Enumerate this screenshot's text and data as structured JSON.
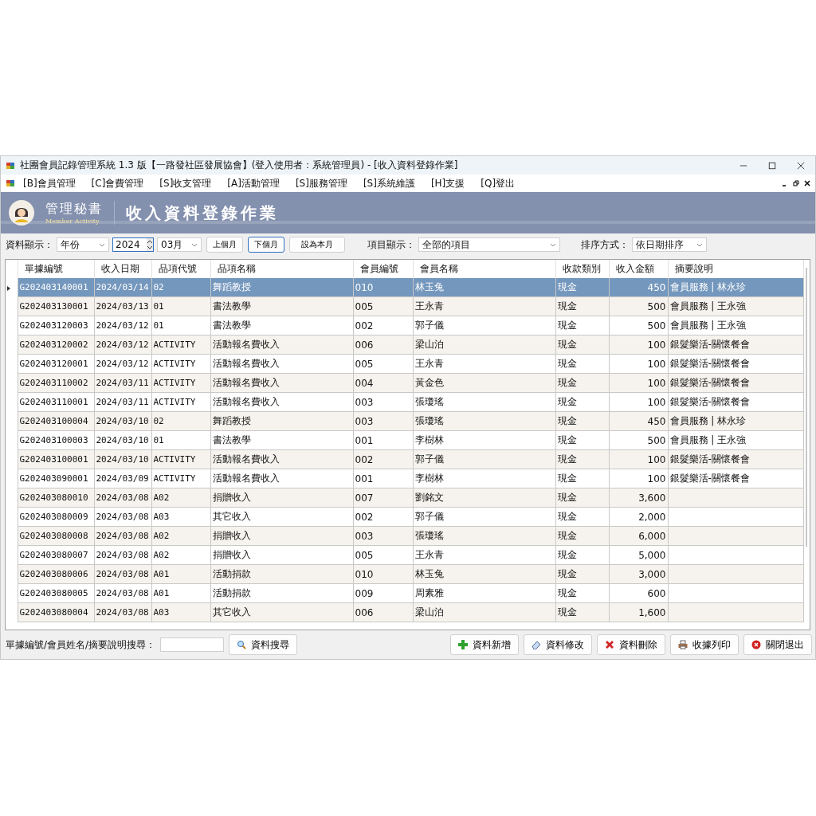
{
  "window": {
    "title": "社團會員記錄管理系統 1.3 版【一路發社區發展協會】(登入使用者：系統管理員) - [收入資料登錄作業]"
  },
  "menu": [
    "[B]會員管理",
    "[C]會費管理",
    "[S]收支管理",
    "[A]活動管理",
    "[S]服務管理",
    "[S]系統維護",
    "[H]支援",
    "[Q]登出"
  ],
  "banner": {
    "brand": "管理秘書",
    "subtitle": "Member Activity",
    "title": "收入資料登錄作業"
  },
  "filters": {
    "display_label": "資料顯示：",
    "period": "年份",
    "year": "2024",
    "month": "03月",
    "buttons": [
      "上個月",
      "下個月",
      "設為本月"
    ],
    "item_label": "項目顯示：",
    "item": "全部的項目",
    "sort_label": "排序方式：",
    "sort": "依日期排序"
  },
  "table": {
    "columns": [
      "單據編號",
      "收入日期",
      "品項代號",
      "品項名稱",
      "會員編號",
      "會員名稱",
      "收款類別",
      "收入金額",
      "摘要說明"
    ],
    "rows": [
      {
        "cells": [
          "G202403140001",
          "2024/03/14",
          "02",
          "舞蹈教授",
          "010",
          "林玉兔",
          "現金",
          "450",
          "會員服務 | 林永珍"
        ],
        "selected": true
      },
      {
        "cells": [
          "G202403130001",
          "2024/03/13",
          "01",
          "書法教學",
          "005",
          "王永青",
          "現金",
          "500",
          "會員服務 | 王永強"
        ],
        "selected": false
      },
      {
        "cells": [
          "G202403120003",
          "2024/03/12",
          "01",
          "書法教學",
          "002",
          "郭子儀",
          "現金",
          "500",
          "會員服務 | 王永強"
        ],
        "selected": false
      },
      {
        "cells": [
          "G202403120002",
          "2024/03/12",
          "ACTIVITY",
          "活動報名費收入",
          "006",
          "梁山泊",
          "現金",
          "100",
          "銀髮樂活-關懷餐會"
        ],
        "selected": false
      },
      {
        "cells": [
          "G202403120001",
          "2024/03/12",
          "ACTIVITY",
          "活動報名費收入",
          "005",
          "王永青",
          "現金",
          "100",
          "銀髮樂活-關懷餐會"
        ],
        "selected": false
      },
      {
        "cells": [
          "G202403110002",
          "2024/03/11",
          "ACTIVITY",
          "活動報名費收入",
          "004",
          "黃金色",
          "現金",
          "100",
          "銀髮樂活-關懷餐會"
        ],
        "selected": false
      },
      {
        "cells": [
          "G202403110001",
          "2024/03/11",
          "ACTIVITY",
          "活動報名費收入",
          "003",
          "張瓊瑤",
          "現金",
          "100",
          "銀髮樂活-關懷餐會"
        ],
        "selected": false
      },
      {
        "cells": [
          "G202403100004",
          "2024/03/10",
          "02",
          "舞蹈教授",
          "003",
          "張瓊瑤",
          "現金",
          "450",
          "會員服務 | 林永珍"
        ],
        "selected": false
      },
      {
        "cells": [
          "G202403100003",
          "2024/03/10",
          "01",
          "書法教學",
          "001",
          "李樹林",
          "現金",
          "500",
          "會員服務 | 王永強"
        ],
        "selected": false
      },
      {
        "cells": [
          "G202403100001",
          "2024/03/10",
          "ACTIVITY",
          "活動報名費收入",
          "002",
          "郭子儀",
          "現金",
          "100",
          "銀髮樂活-關懷餐會"
        ],
        "selected": false
      },
      {
        "cells": [
          "G202403090001",
          "2024/03/09",
          "ACTIVITY",
          "活動報名費收入",
          "001",
          "李樹林",
          "現金",
          "100",
          "銀髮樂活-關懷餐會"
        ],
        "selected": false
      },
      {
        "cells": [
          "G202403080010",
          "2024/03/08",
          "A02",
          "捐贈收入",
          "007",
          "劉銘文",
          "現金",
          "3,600"
        ],
        "selected": false
      },
      {
        "cells": [
          "G202403080009",
          "2024/03/08",
          "A03",
          "其它收入",
          "002",
          "郭子儀",
          "現金",
          "2,000"
        ],
        "selected": false
      },
      {
        "cells": [
          "G202403080008",
          "2024/03/08",
          "A02",
          "捐贈收入",
          "003",
          "張瓊瑤",
          "現金",
          "6,000"
        ],
        "selected": false
      },
      {
        "cells": [
          "G202403080007",
          "2024/03/08",
          "A02",
          "捐贈收入",
          "005",
          "王永青",
          "現金",
          "5,000"
        ],
        "selected": false
      },
      {
        "cells": [
          "G202403080006",
          "2024/03/08",
          "A01",
          "活動捐款",
          "010",
          "林玉兔",
          "現金",
          "3,000"
        ],
        "selected": false
      },
      {
        "cells": [
          "G202403080005",
          "2024/03/08",
          "A01",
          "活動捐款",
          "009",
          "周素雅",
          "現金",
          "600"
        ],
        "selected": false
      },
      {
        "cells": [
          "G202403080004",
          "2024/03/08",
          "A03",
          "其它收入",
          "006",
          "梁山泊",
          "現金",
          "1,600"
        ],
        "selected": false
      }
    ]
  },
  "footer": {
    "search_label": "單據編號/會員姓名/摘要說明搜尋：",
    "search_button": "資料搜尋",
    "actions": [
      {
        "kind": "add",
        "label": "資料新增"
      },
      {
        "kind": "edit",
        "label": "資料修改"
      },
      {
        "kind": "delete",
        "label": "資料刪除"
      },
      {
        "kind": "print",
        "label": "收據列印"
      },
      {
        "kind": "close",
        "label": "關閉退出"
      }
    ]
  }
}
